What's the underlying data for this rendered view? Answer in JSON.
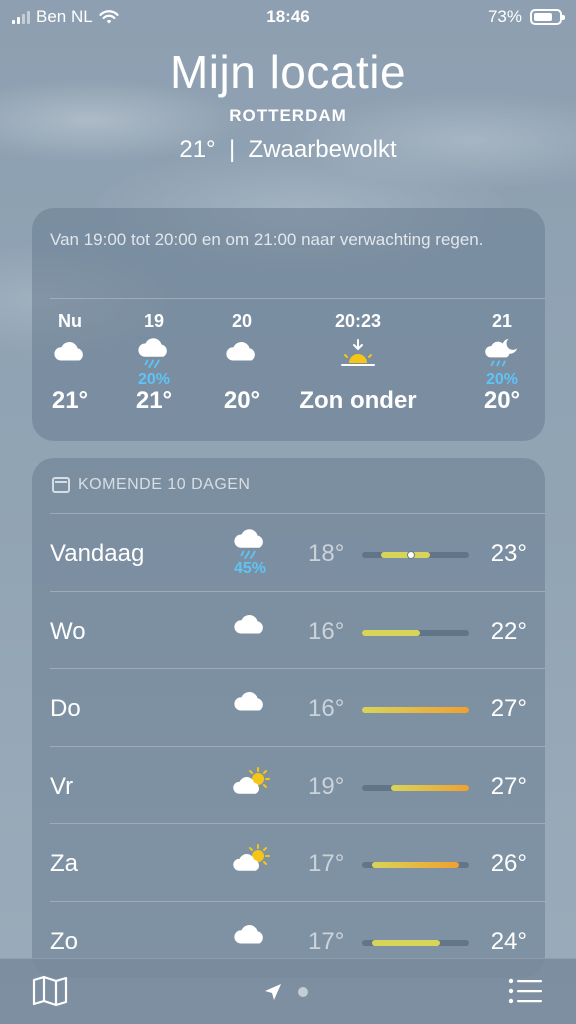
{
  "status_bar": {
    "carrier": "Ben NL",
    "time": "18:46",
    "battery": "73%",
    "battery_level": 0.73
  },
  "header": {
    "title": "Mijn locatie",
    "city": "ROTTERDAM",
    "current": "21°  |  Zwaarbewolkt"
  },
  "hourly": {
    "summary": "Van 19:00 tot 20:00 en om 21:00 naar verwachting regen.",
    "items": [
      {
        "label": "Nu",
        "icon": "cloud-icon",
        "pct": "",
        "temp": "21°"
      },
      {
        "label": "19",
        "icon": "cloud-rain-icon",
        "pct": "20%",
        "temp": "21°"
      },
      {
        "label": "20",
        "icon": "cloud-icon",
        "pct": "",
        "temp": "20°"
      },
      {
        "label": "20:23",
        "icon": "sunset-icon",
        "pct": "",
        "temp": "Zon onder"
      },
      {
        "label": "21",
        "icon": "cloud-moon-rain-icon",
        "pct": "20%",
        "temp": "20°"
      }
    ]
  },
  "daily": {
    "heading": "KOMENDE 10 DAGEN",
    "range_min": 16,
    "range_max": 27,
    "current_temp": 21,
    "days": [
      {
        "name": "Vandaag",
        "icon": "cloud-rain-icon",
        "pct": "45%",
        "low": "18°",
        "high": "23°",
        "low_val": 18,
        "high_val": 23
      },
      {
        "name": "Wo",
        "icon": "cloud-icon",
        "pct": "",
        "low": "16°",
        "high": "22°",
        "low_val": 16,
        "high_val": 22
      },
      {
        "name": "Do",
        "icon": "cloud-icon",
        "pct": "",
        "low": "16°",
        "high": "27°",
        "low_val": 16,
        "high_val": 27
      },
      {
        "name": "Vr",
        "icon": "sun-cloud-icon",
        "pct": "",
        "low": "19°",
        "high": "27°",
        "low_val": 19,
        "high_val": 27
      },
      {
        "name": "Za",
        "icon": "sun-cloud-icon",
        "pct": "",
        "low": "17°",
        "high": "26°",
        "low_val": 17,
        "high_val": 26
      },
      {
        "name": "Zo",
        "icon": "cloud-icon",
        "pct": "",
        "low": "17°",
        "high": "24°",
        "low_val": 17,
        "high_val": 24
      }
    ]
  },
  "colors": {
    "precip": "#5fc3f5",
    "bar_cool": "#d8d45a",
    "bar_warm": "#f0a030"
  },
  "bottom_bar": {
    "map_icon": "map-icon",
    "location_icon": "location-arrow-icon",
    "list_icon": "list-icon"
  }
}
